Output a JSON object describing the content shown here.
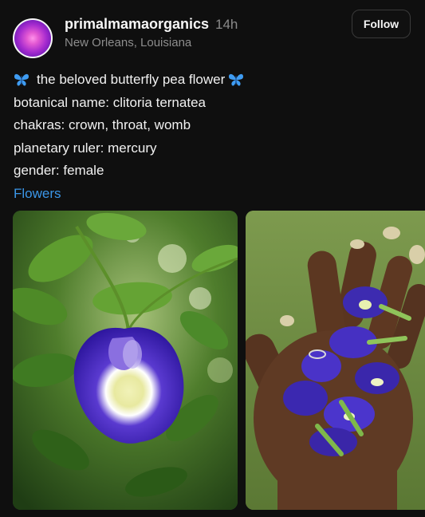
{
  "post": {
    "username": "primalmamaorganics",
    "time": "14h",
    "location": "New Orleans, Louisiana",
    "follow_label": "Follow",
    "caption": {
      "title": "the beloved butterfly pea flower",
      "lines": [
        "botanical name: clitoria ternatea",
        "chakras: crown, throat, womb",
        "planetary ruler: mercury",
        "gender: female"
      ],
      "tag": "Flowers"
    },
    "colors": {
      "background": "#0f0f0f",
      "link": "#3b96e8",
      "flower": "#4b2bb8"
    },
    "icons": [
      "butterfly-icon",
      "butterfly-icon"
    ]
  }
}
